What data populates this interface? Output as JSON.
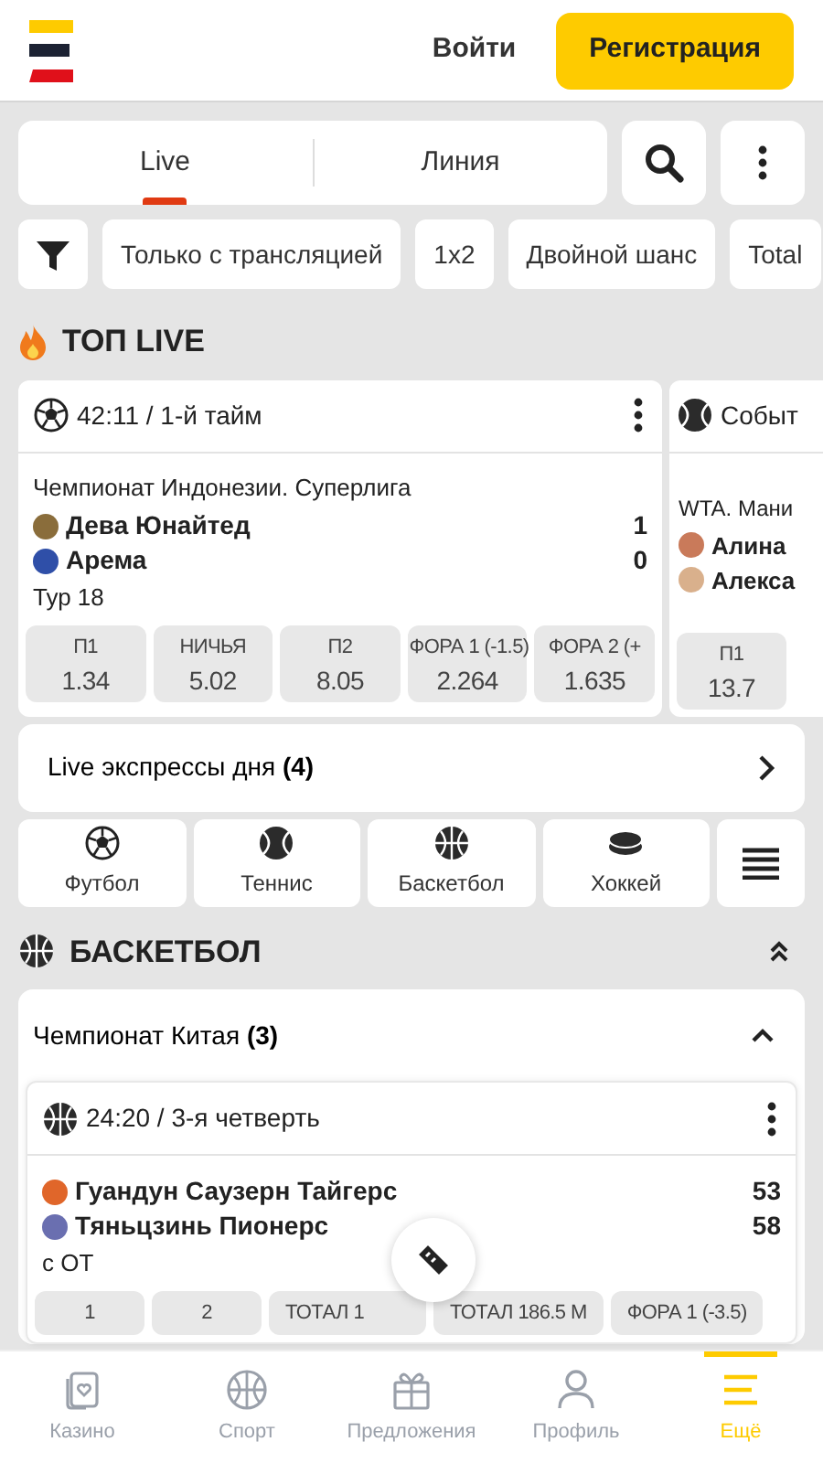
{
  "header": {
    "login": "Войти",
    "register": "Регистрация"
  },
  "tabs": [
    {
      "label": "Live",
      "selected": true
    },
    {
      "label": "Линия",
      "selected": false
    }
  ],
  "filters": [
    "Только с трансляцией",
    "1x2",
    "Двойной шанс",
    "Total"
  ],
  "top_live": {
    "title": "ТОП LIVE",
    "matches": [
      {
        "kind": "football",
        "status": "42:11 / 1-й тайм",
        "league": "Чемпионат Индонезии. Суперлига",
        "teams": [
          {
            "name": "Дева Юнайтед",
            "score": "1",
            "color": "#8a6d3b"
          },
          {
            "name": "Арема",
            "score": "0",
            "color": "#2f4fa8"
          }
        ],
        "note": "Тур 18",
        "odds": [
          {
            "label": "П1",
            "value": "1.34"
          },
          {
            "label": "НИЧЬЯ",
            "value": "5.02"
          },
          {
            "label": "П2",
            "value": "8.05"
          },
          {
            "label": "ФОРА 1 (-1.5)",
            "value": "2.264"
          },
          {
            "label": "ФОРА 2 (+",
            "value": "1.635"
          }
        ]
      },
      {
        "kind": "tennis",
        "status": "Событ",
        "league": "WTA. Мани",
        "teams": [
          {
            "name": "Алина",
            "color": "#c97a5a"
          },
          {
            "name": "Алекса",
            "color": "#d9b08c"
          }
        ],
        "odds": [
          {
            "label": "П1",
            "value": "13.7"
          }
        ]
      }
    ]
  },
  "express": {
    "text": "Live экспрессы дня **(4)**"
  },
  "sports": [
    {
      "kind": "football",
      "label": "Футбол"
    },
    {
      "kind": "tennis",
      "label": "Теннис"
    },
    {
      "kind": "basketball",
      "label": "Баскетбол"
    },
    {
      "kind": "hockey",
      "label": "Хоккей"
    }
  ],
  "section": {
    "kind": "basketball",
    "title": "БАСКЕТБОЛ",
    "expanded": true,
    "leagues": [
      {
        "title": "Чемпионат Китая **(3)**",
        "expanded": true,
        "matches": [
          {
            "kind": "basketball",
            "status": "24:20 / 3-я четверть",
            "teams": [
              {
                "name": "Гуандун Саузерн Тайгерс",
                "score": "53",
                "color": "#e0662a"
              },
              {
                "name": "Тяньцзинь Пионерс",
                "score": "58",
                "color": "#6a6fb0"
              }
            ],
            "note": "с ОТ",
            "odds": [
              {
                "label": "1"
              },
              {
                "label": "2"
              },
              {
                "label": "ТОТАЛ 1"
              },
              {
                "label": "ТОТАЛ 186.5 М"
              },
              {
                "label": "ФОРА 1 (-3.5)"
              }
            ]
          }
        ]
      }
    ]
  },
  "nav": [
    {
      "kind": "casino",
      "label": "Казино",
      "selected": false
    },
    {
      "kind": "sport",
      "label": "Спорт",
      "selected": false
    },
    {
      "kind": "offers",
      "label": "Предложения",
      "selected": false
    },
    {
      "kind": "profile",
      "label": "Профиль",
      "selected": false
    },
    {
      "kind": "more",
      "label": "Ещё",
      "selected": true
    }
  ]
}
